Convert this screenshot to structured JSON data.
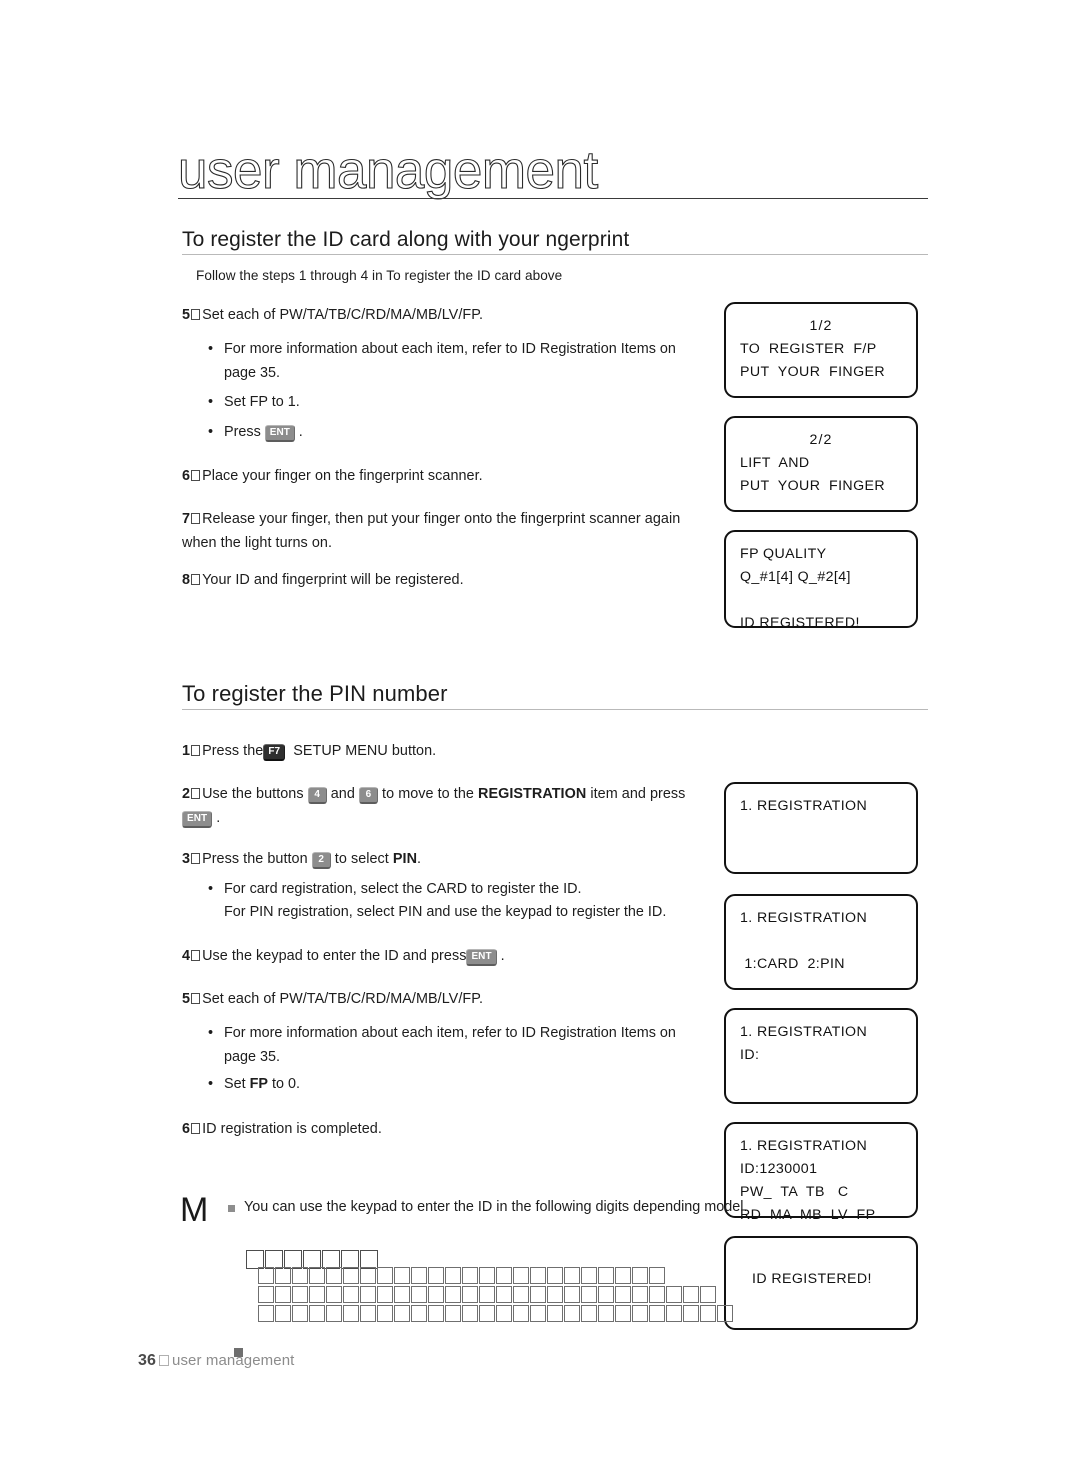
{
  "document": {
    "chapter_title": "user management",
    "footer": {
      "page_number": "36",
      "label": "user management"
    }
  },
  "sections": [
    {
      "heading": "To register the ID card along with your  ngerprint",
      "intro": "Follow the steps 1 through 4 in  To register the ID card  above",
      "steps": [
        {
          "num": "5",
          "text": "Set each of PW/TA/TB/C/RD/MA/MB/LV/FP.",
          "bullets": [
            "For more information about each item, refer to  ID Registration Items  on page 35.",
            "Set FP to 1.",
            "Press"
          ]
        },
        {
          "num": "6",
          "text": "Place your finger on the fingerprint scanner."
        },
        {
          "num": "7",
          "text": "Release your finger, then put your finger onto the fingerprint scanner again when the light turns on."
        },
        {
          "num": "8",
          "text": "Your ID and fingerprint will be registered."
        }
      ],
      "displays": [
        {
          "lines": [
            "1/2",
            "TO  REGISTER  F/P",
            "PUT  YOUR  FINGER"
          ]
        },
        {
          "lines": [
            "2/2",
            "LIFT  AND",
            "PUT  YOUR  FINGER"
          ]
        },
        {
          "lines": [
            "FP QUALITY",
            "Q_#1[4] Q_#2[4]",
            "",
            "ID REGISTERED!"
          ]
        }
      ]
    },
    {
      "heading": "To register the PIN number",
      "steps": [
        {
          "num": "1",
          "pre": "Press the",
          "key": "F7",
          "post": "SETUP MENU button."
        },
        {
          "num": "2",
          "pre": "Use the buttons",
          "key_a": "4",
          "mid": "and",
          "key_b": "6",
          "post": "to move to the",
          "bold": "REGISTRATION",
          "post2": "item and press",
          "key_c": "ENT",
          "post3": "."
        },
        {
          "num": "3",
          "pre": "Press the button",
          "key": "2",
          "post": "to select",
          "bold": "PIN",
          "post2": ".",
          "bullets": [
            "For card registration, select the CARD to register the ID.",
            "For PIN registration, select PIN and use the keypad to register the ID."
          ]
        },
        {
          "num": "4",
          "pre": "Use the keypad to enter the ID and press",
          "key": "ENT",
          "post": "."
        },
        {
          "num": "5",
          "text": "Set each of PW/TA/TB/C/RD/MA/MB/LV/FP.",
          "bullets": [
            "For more information about each item, refer to  ID Registration Items  on page 35.",
            "Set FP to 0."
          ]
        },
        {
          "num": "6",
          "text": "ID registration is completed."
        }
      ],
      "displays": [
        {
          "lines": [
            "1. REGISTRATION"
          ]
        },
        {
          "lines": [
            "1. REGISTRATION",
            "",
            " 1:CARD  2:PIN"
          ]
        },
        {
          "lines": [
            "1. REGISTRATION",
            "ID:"
          ]
        },
        {
          "lines": [
            "1. REGISTRATION",
            "ID:1230001",
            "PW_  TA  TB   C",
            "RD  MA  MB  LV  FP"
          ]
        },
        {
          "lines": [
            "ID REGISTERED!"
          ]
        }
      ]
    }
  ],
  "note": {
    "marker": "M",
    "text": "You can use the keypad to enter the ID in the following digits depending model.",
    "unrendered_rows": [
      7,
      24,
      27,
      28
    ]
  },
  "keys": {
    "ent": "ENT",
    "f7": "F7",
    "k4": "4",
    "k6": "6",
    "k2": "2"
  },
  "colors": {
    "ink": "#1d1d1d",
    "key_gray": "#8d8d8d",
    "key_dark": "#2f2f2f",
    "rule_gray": "#b9b9b9",
    "footer_gray": "#8c8c8c"
  }
}
